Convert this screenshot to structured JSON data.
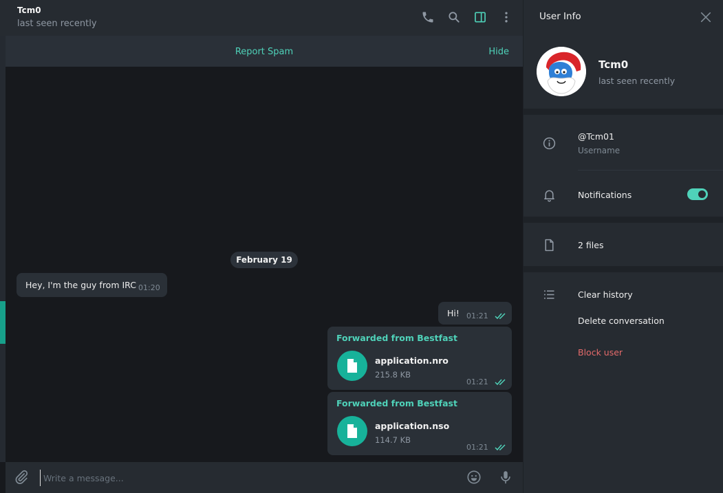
{
  "header": {
    "title": "Tcm0",
    "status": "last seen recently",
    "icons": [
      "phone-icon",
      "search-icon",
      "sidebar-toggle-icon",
      "more-vertical-icon"
    ]
  },
  "spam_bar": {
    "report_label": "Report Spam",
    "hide_label": "Hide"
  },
  "messages": {
    "date": "February 19",
    "incoming": {
      "text": "Hey, I'm the guy from IRC",
      "time": "01:20"
    },
    "outgoing": {
      "text": "Hi!",
      "time": "01:21"
    },
    "files": [
      {
        "forwarded": "Forwarded from Bestfast",
        "name": "application.nro",
        "size": "215.8 KB",
        "time": "01:21"
      },
      {
        "forwarded": "Forwarded from Bestfast",
        "name": "application.nso",
        "size": "114.7 KB",
        "time": "01:21"
      }
    ]
  },
  "composer": {
    "placeholder": "Write a message...",
    "icons": [
      "attach-icon",
      "emoji-icon",
      "microphone-icon"
    ]
  },
  "panel": {
    "title": "User Info",
    "profile": {
      "name": "Tcm0",
      "status": "last seen recently"
    },
    "username": {
      "value": "@Tcm01",
      "label": "Username"
    },
    "notifications": {
      "label": "Notifications",
      "enabled": true
    },
    "files": {
      "label": "2 files"
    },
    "actions": {
      "clear_history": "Clear history",
      "delete_conversation": "Delete conversation",
      "block_user": "Block user"
    }
  },
  "colors": {
    "accent": "#4fd2b9",
    "danger": "#e56b6b",
    "file_icon_bg": "#17b29a",
    "bubble": "#2a3037",
    "background": "#17191d"
  }
}
